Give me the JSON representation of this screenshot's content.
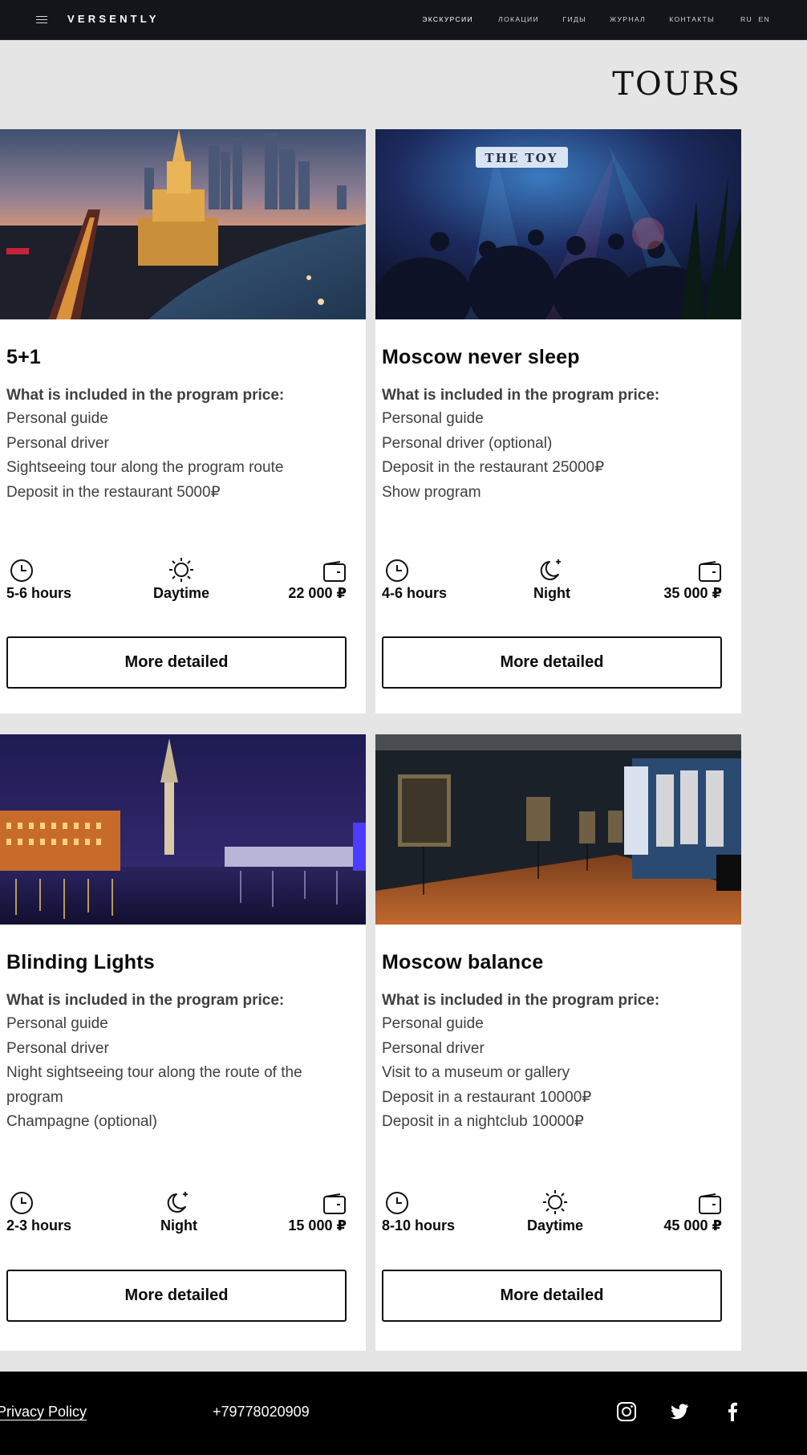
{
  "header": {
    "logo": "VERSENTLY",
    "nav": [
      {
        "label": "ЭКСКУРСИИ",
        "active": true
      },
      {
        "label": "ЛОКАЦИИ",
        "active": false
      },
      {
        "label": "ГИДЫ",
        "active": false
      },
      {
        "label": "ЖУРНАЛ",
        "active": false
      },
      {
        "label": "КОНТАКТЫ",
        "active": false
      }
    ],
    "languages": [
      "RU",
      "EN"
    ]
  },
  "page_title": "TOURS",
  "cards": [
    {
      "title": "5+1",
      "included_heading": "What is included in the program price:",
      "items": [
        "Personal guide",
        "Personal driver",
        "Sightseeing tour along the program route",
        "Deposit in the restaurant 5000₽"
      ],
      "duration": "5-6 hours",
      "time_of_day": "Daytime",
      "time_icon": "sun-icon",
      "price": "22 000 ₽",
      "button": "More detailed",
      "photo": "moscow-city-skyline-dusk-image"
    },
    {
      "title": "Moscow never sleep",
      "included_heading": "What is included in the program price:",
      "items": [
        "Personal guide",
        "Personal driver (optional)",
        "Deposit in the restaurant 25000₽",
        "Show program"
      ],
      "duration": "4-6 hours",
      "time_of_day": "Night",
      "time_icon": "moon-icon",
      "price": "35 000 ₽",
      "button": "More detailed",
      "photo": "nightclub-party-image",
      "photo_sign": "THE TOY"
    },
    {
      "title": "Blinding Lights",
      "included_heading": "What is included in the program price:",
      "items": [
        "Personal guide",
        "Personal driver",
        "Night sightseeing tour along the route of the program",
        "Champagne (optional)"
      ],
      "duration": "2-3 hours",
      "time_of_day": "Night",
      "time_icon": "moon-icon",
      "price": "15 000 ₽",
      "button": "More detailed",
      "photo": "river-night-lights-image"
    },
    {
      "title": "Moscow balance",
      "included_heading": "What is included in the program price:",
      "items": [
        "Personal guide",
        "Personal driver",
        "Visit to a museum or gallery",
        "Deposit in a restaurant 10000₽",
        "Deposit in a nightclub 10000₽"
      ],
      "duration": "8-10 hours",
      "time_of_day": "Daytime",
      "time_icon": "sun-icon",
      "price": "45 000 ₽",
      "button": "More detailed",
      "photo": "museum-gallery-image"
    }
  ],
  "footer": {
    "privacy": "Privacy Policy",
    "phone": "+79778020909",
    "social": [
      "instagram-icon",
      "twitter-icon",
      "facebook-icon"
    ]
  },
  "colors": {
    "header_bg": "#13151a",
    "page_bg": "#e5e5e5",
    "card_bg": "#ffffff",
    "footer_bg": "#000000"
  }
}
